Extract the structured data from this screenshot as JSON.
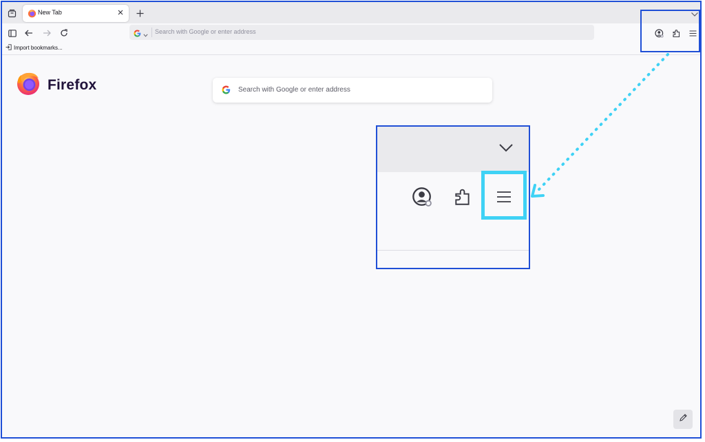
{
  "tab": {
    "title": "New Tab"
  },
  "urlbar": {
    "placeholder": "Search with Google or enter address"
  },
  "bookmarks": {
    "import_label": "Import bookmarks..."
  },
  "content": {
    "brand_name": "Firefox",
    "search_placeholder": "Search with Google or enter address"
  },
  "colors": {
    "annotation_box": "#1f4fd6",
    "annotation_highlight": "#3fd2f5",
    "arrow": "#3fd2f5",
    "tabstrip_bg": "#eaeaed",
    "page_bg": "#f9f9fb"
  },
  "icons": {
    "tab_overview": "tab-overview-icon",
    "favicon": "firefox-favicon-icon",
    "close": "close-icon",
    "new_tab": "plus-icon",
    "sidebar": "sidebar-icon",
    "back": "back-arrow-icon",
    "forward": "forward-arrow-icon",
    "reload": "reload-icon",
    "search_engine": "google-icon",
    "account": "account-icon",
    "extensions": "puzzle-icon",
    "menu": "hamburger-menu-icon",
    "import": "import-icon",
    "edit": "pencil-icon"
  }
}
